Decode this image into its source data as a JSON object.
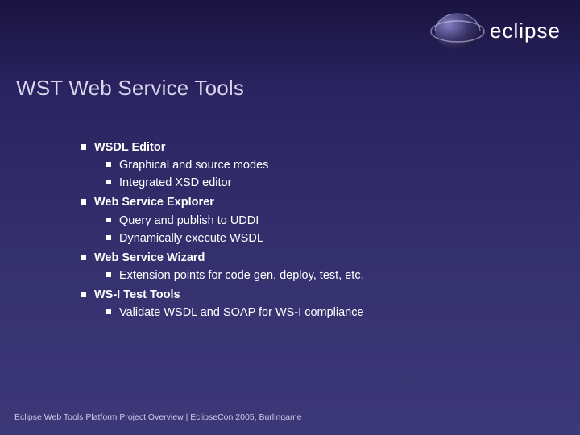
{
  "logo_text": "eclipse",
  "title": "WST Web Service Tools",
  "sections": [
    {
      "heading": "WSDL Editor",
      "items": [
        "Graphical and source modes",
        "Integrated XSD editor"
      ]
    },
    {
      "heading": "Web Service Explorer",
      "items": [
        "Query and publish to UDDI",
        "Dynamically execute WSDL"
      ]
    },
    {
      "heading": "Web Service Wizard",
      "items": [
        "Extension points for code gen, deploy, test, etc."
      ]
    },
    {
      "heading": "WS-I Test Tools",
      "items": [
        "Validate WSDL and SOAP for WS-I compliance"
      ]
    }
  ],
  "footer": "Eclipse Web Tools Platform Project Overview   |   EclipseCon 2005, Burlingame"
}
